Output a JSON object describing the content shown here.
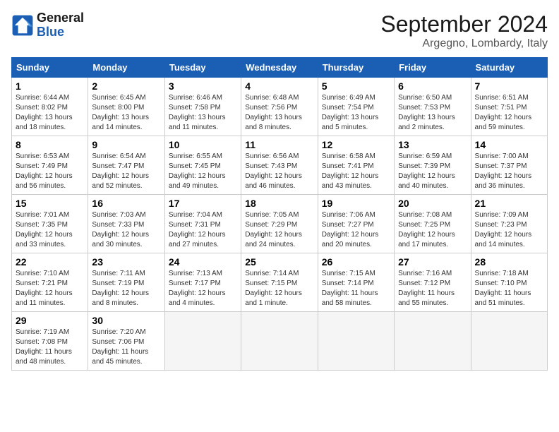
{
  "header": {
    "logo_general": "General",
    "logo_blue": "Blue",
    "month_title": "September 2024",
    "location": "Argegno, Lombardy, Italy"
  },
  "columns": [
    "Sunday",
    "Monday",
    "Tuesday",
    "Wednesday",
    "Thursday",
    "Friday",
    "Saturday"
  ],
  "weeks": [
    [
      {
        "day": "1",
        "sunrise": "Sunrise: 6:44 AM",
        "sunset": "Sunset: 8:02 PM",
        "daylight": "Daylight: 13 hours and 18 minutes."
      },
      {
        "day": "2",
        "sunrise": "Sunrise: 6:45 AM",
        "sunset": "Sunset: 8:00 PM",
        "daylight": "Daylight: 13 hours and 14 minutes."
      },
      {
        "day": "3",
        "sunrise": "Sunrise: 6:46 AM",
        "sunset": "Sunset: 7:58 PM",
        "daylight": "Daylight: 13 hours and 11 minutes."
      },
      {
        "day": "4",
        "sunrise": "Sunrise: 6:48 AM",
        "sunset": "Sunset: 7:56 PM",
        "daylight": "Daylight: 13 hours and 8 minutes."
      },
      {
        "day": "5",
        "sunrise": "Sunrise: 6:49 AM",
        "sunset": "Sunset: 7:54 PM",
        "daylight": "Daylight: 13 hours and 5 minutes."
      },
      {
        "day": "6",
        "sunrise": "Sunrise: 6:50 AM",
        "sunset": "Sunset: 7:53 PM",
        "daylight": "Daylight: 13 hours and 2 minutes."
      },
      {
        "day": "7",
        "sunrise": "Sunrise: 6:51 AM",
        "sunset": "Sunset: 7:51 PM",
        "daylight": "Daylight: 12 hours and 59 minutes."
      }
    ],
    [
      {
        "day": "8",
        "sunrise": "Sunrise: 6:53 AM",
        "sunset": "Sunset: 7:49 PM",
        "daylight": "Daylight: 12 hours and 56 minutes."
      },
      {
        "day": "9",
        "sunrise": "Sunrise: 6:54 AM",
        "sunset": "Sunset: 7:47 PM",
        "daylight": "Daylight: 12 hours and 52 minutes."
      },
      {
        "day": "10",
        "sunrise": "Sunrise: 6:55 AM",
        "sunset": "Sunset: 7:45 PM",
        "daylight": "Daylight: 12 hours and 49 minutes."
      },
      {
        "day": "11",
        "sunrise": "Sunrise: 6:56 AM",
        "sunset": "Sunset: 7:43 PM",
        "daylight": "Daylight: 12 hours and 46 minutes."
      },
      {
        "day": "12",
        "sunrise": "Sunrise: 6:58 AM",
        "sunset": "Sunset: 7:41 PM",
        "daylight": "Daylight: 12 hours and 43 minutes."
      },
      {
        "day": "13",
        "sunrise": "Sunrise: 6:59 AM",
        "sunset": "Sunset: 7:39 PM",
        "daylight": "Daylight: 12 hours and 40 minutes."
      },
      {
        "day": "14",
        "sunrise": "Sunrise: 7:00 AM",
        "sunset": "Sunset: 7:37 PM",
        "daylight": "Daylight: 12 hours and 36 minutes."
      }
    ],
    [
      {
        "day": "15",
        "sunrise": "Sunrise: 7:01 AM",
        "sunset": "Sunset: 7:35 PM",
        "daylight": "Daylight: 12 hours and 33 minutes."
      },
      {
        "day": "16",
        "sunrise": "Sunrise: 7:03 AM",
        "sunset": "Sunset: 7:33 PM",
        "daylight": "Daylight: 12 hours and 30 minutes."
      },
      {
        "day": "17",
        "sunrise": "Sunrise: 7:04 AM",
        "sunset": "Sunset: 7:31 PM",
        "daylight": "Daylight: 12 hours and 27 minutes."
      },
      {
        "day": "18",
        "sunrise": "Sunrise: 7:05 AM",
        "sunset": "Sunset: 7:29 PM",
        "daylight": "Daylight: 12 hours and 24 minutes."
      },
      {
        "day": "19",
        "sunrise": "Sunrise: 7:06 AM",
        "sunset": "Sunset: 7:27 PM",
        "daylight": "Daylight: 12 hours and 20 minutes."
      },
      {
        "day": "20",
        "sunrise": "Sunrise: 7:08 AM",
        "sunset": "Sunset: 7:25 PM",
        "daylight": "Daylight: 12 hours and 17 minutes."
      },
      {
        "day": "21",
        "sunrise": "Sunrise: 7:09 AM",
        "sunset": "Sunset: 7:23 PM",
        "daylight": "Daylight: 12 hours and 14 minutes."
      }
    ],
    [
      {
        "day": "22",
        "sunrise": "Sunrise: 7:10 AM",
        "sunset": "Sunset: 7:21 PM",
        "daylight": "Daylight: 12 hours and 11 minutes."
      },
      {
        "day": "23",
        "sunrise": "Sunrise: 7:11 AM",
        "sunset": "Sunset: 7:19 PM",
        "daylight": "Daylight: 12 hours and 8 minutes."
      },
      {
        "day": "24",
        "sunrise": "Sunrise: 7:13 AM",
        "sunset": "Sunset: 7:17 PM",
        "daylight": "Daylight: 12 hours and 4 minutes."
      },
      {
        "day": "25",
        "sunrise": "Sunrise: 7:14 AM",
        "sunset": "Sunset: 7:15 PM",
        "daylight": "Daylight: 12 hours and 1 minute."
      },
      {
        "day": "26",
        "sunrise": "Sunrise: 7:15 AM",
        "sunset": "Sunset: 7:14 PM",
        "daylight": "Daylight: 11 hours and 58 minutes."
      },
      {
        "day": "27",
        "sunrise": "Sunrise: 7:16 AM",
        "sunset": "Sunset: 7:12 PM",
        "daylight": "Daylight: 11 hours and 55 minutes."
      },
      {
        "day": "28",
        "sunrise": "Sunrise: 7:18 AM",
        "sunset": "Sunset: 7:10 PM",
        "daylight": "Daylight: 11 hours and 51 minutes."
      }
    ],
    [
      {
        "day": "29",
        "sunrise": "Sunrise: 7:19 AM",
        "sunset": "Sunset: 7:08 PM",
        "daylight": "Daylight: 11 hours and 48 minutes."
      },
      {
        "day": "30",
        "sunrise": "Sunrise: 7:20 AM",
        "sunset": "Sunset: 7:06 PM",
        "daylight": "Daylight: 11 hours and 45 minutes."
      },
      null,
      null,
      null,
      null,
      null
    ]
  ]
}
